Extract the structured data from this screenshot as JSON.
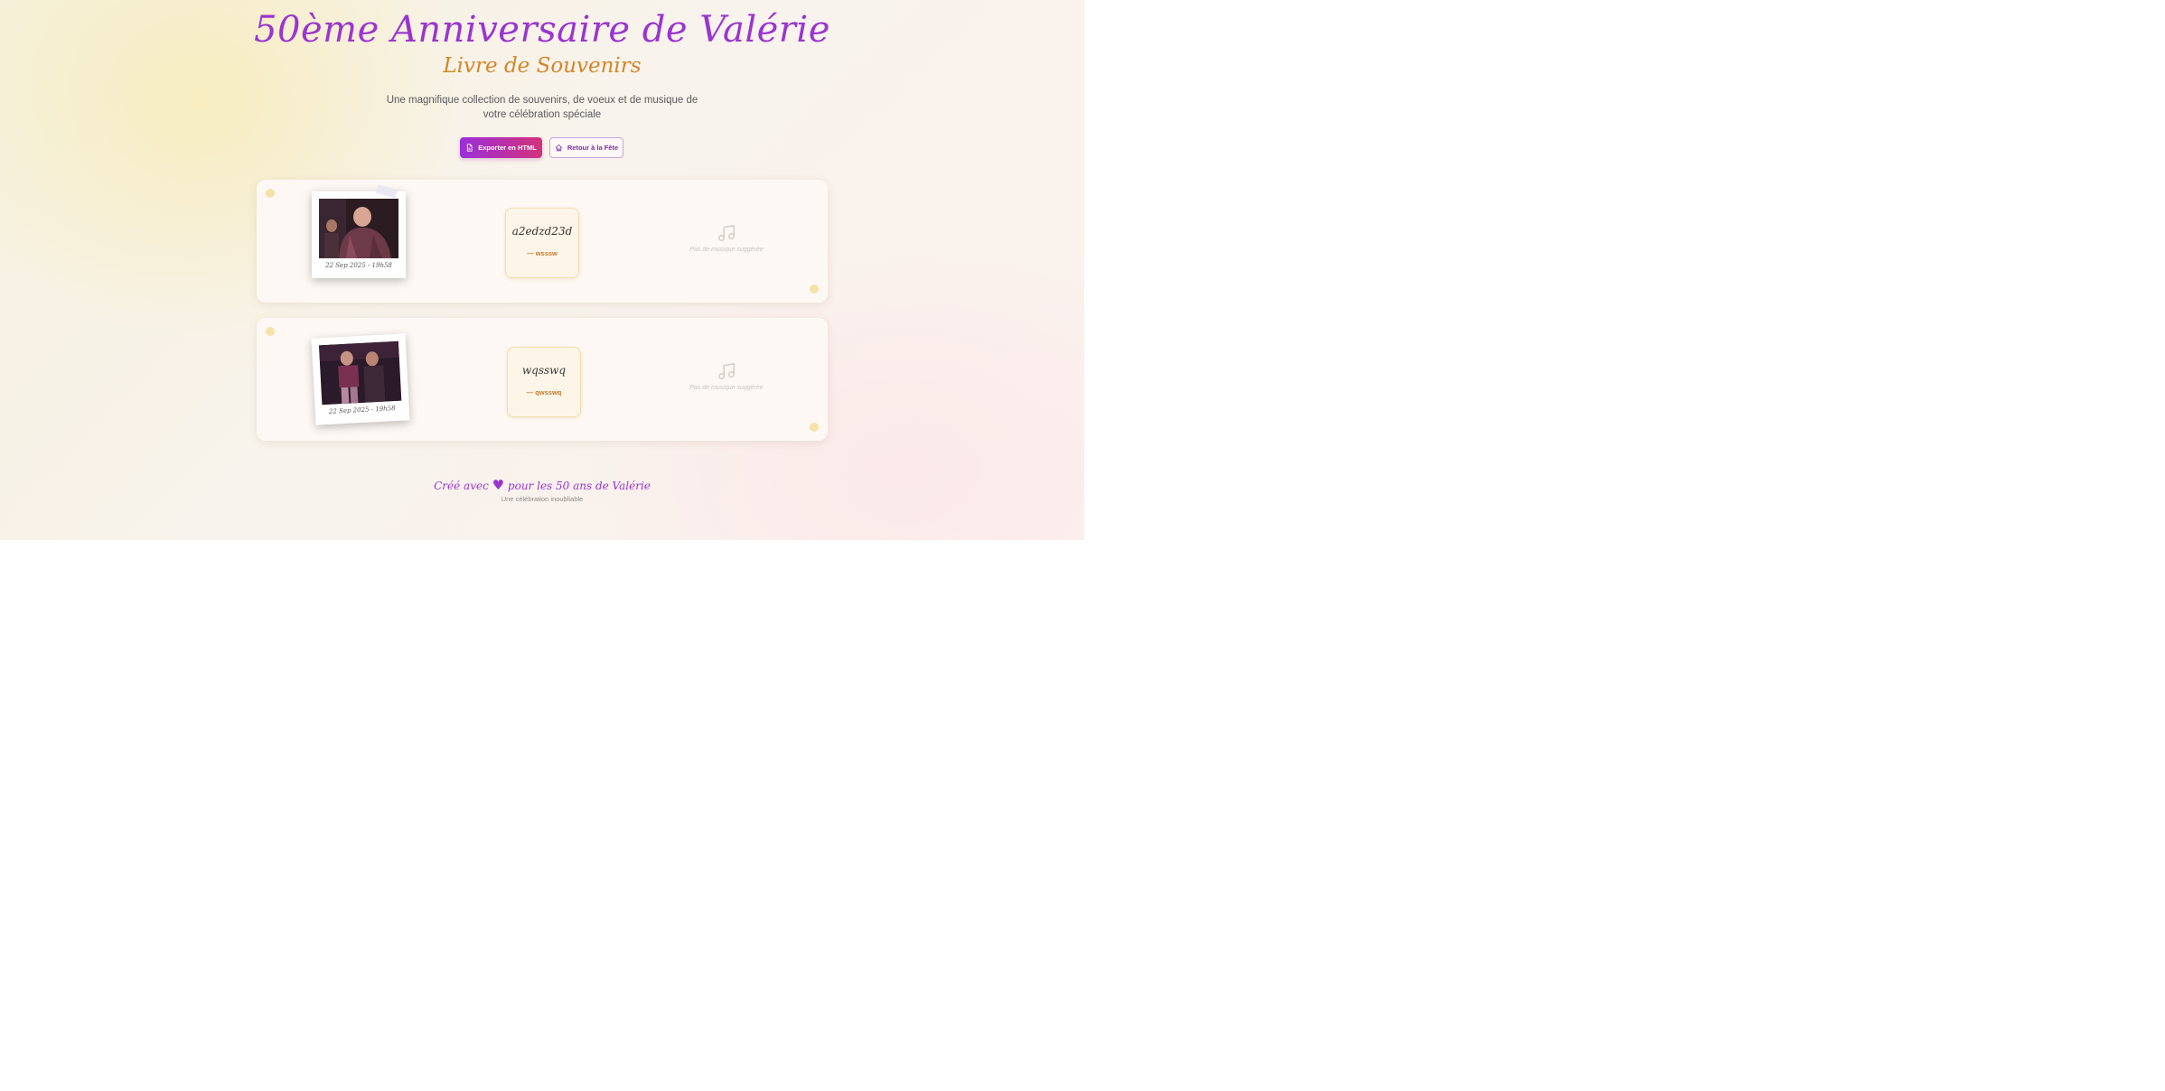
{
  "header": {
    "title": "50ème Anniversaire de Valérie",
    "subtitle": "Livre de Souvenirs",
    "description": "Une magnifique collection de souvenirs, de voeux et de musique de votre célébration spéciale"
  },
  "actions": {
    "export_label": "Exporter en HTML",
    "back_label": "Retour à la Fête"
  },
  "memories": [
    {
      "photo_caption": "22 Sep 2025 - 19h58",
      "wish_text": "a2edzd23d",
      "wish_author": "— wsssw",
      "music_text": "Pas de musique suggérée"
    },
    {
      "photo_caption": "22 Sep 2025 - 19h58",
      "wish_text": "wqsswq",
      "wish_author": "— qwsswq",
      "music_text": "Pas de musique suggérée"
    }
  ],
  "footer": {
    "line_before": "Créé avec",
    "line_after": "pour les 50 ans de Valérie",
    "subline": "Une célébration inoubliable"
  },
  "colors": {
    "accent_purple": "#9a35cf",
    "accent_gold": "#d3862a",
    "button_gradient_start": "#9b2fd9",
    "button_gradient_end": "#d2327a"
  },
  "icons": {
    "export": "file-icon",
    "back": "home-icon",
    "music": "music-note-icon",
    "heart": "heart-icon"
  }
}
